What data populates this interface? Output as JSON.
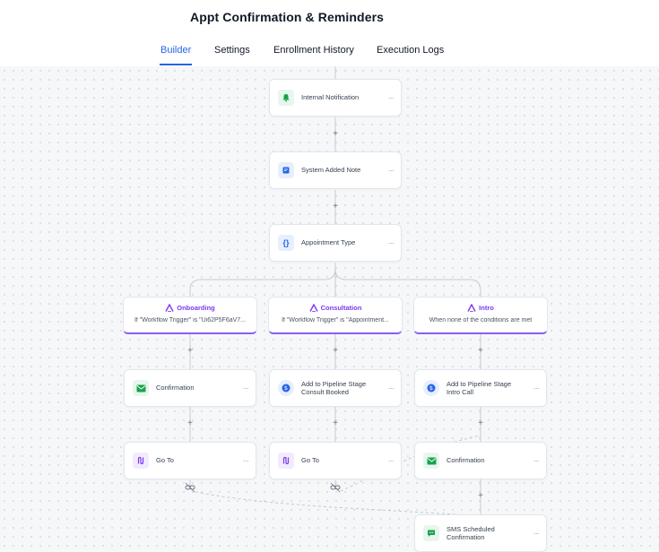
{
  "header": {
    "title": "Appt Confirmation & Reminders"
  },
  "tabs": [
    {
      "label": "Builder",
      "active": true
    },
    {
      "label": "Settings",
      "active": false
    },
    {
      "label": "Enrollment History",
      "active": false
    },
    {
      "label": "Execution Logs",
      "active": false
    }
  ],
  "nodes": {
    "internal_notification": "Internal Notification",
    "system_added_note": "System Added Note",
    "appointment_type": "Appointment Type",
    "confirmation_1": "Confirmation",
    "add_pipeline_consult": "Add to Pipeline Stage Consult Booked",
    "add_pipeline_intro": "Add to Pipeline Stage Intro Call",
    "goto_1": "Go To",
    "goto_2": "Go To",
    "confirmation_3": "Confirmation",
    "sms_scheduled": "SMS Scheduled Confirmation"
  },
  "branches": [
    {
      "title": "Onboarding",
      "condition": "If \"Workflow Trigger\" is \"Ui62P5F6aV7..."
    },
    {
      "title": "Consultation",
      "condition": "If \"Workflow Trigger\" is \"Appointment..."
    },
    {
      "title": "Intro",
      "condition": "When none of the conditions are met"
    }
  ],
  "more_label": "...",
  "plus_label": "+",
  "colors": {
    "accent": "#2563eb",
    "branch": "#7c3aed",
    "success": "#16a34a"
  }
}
